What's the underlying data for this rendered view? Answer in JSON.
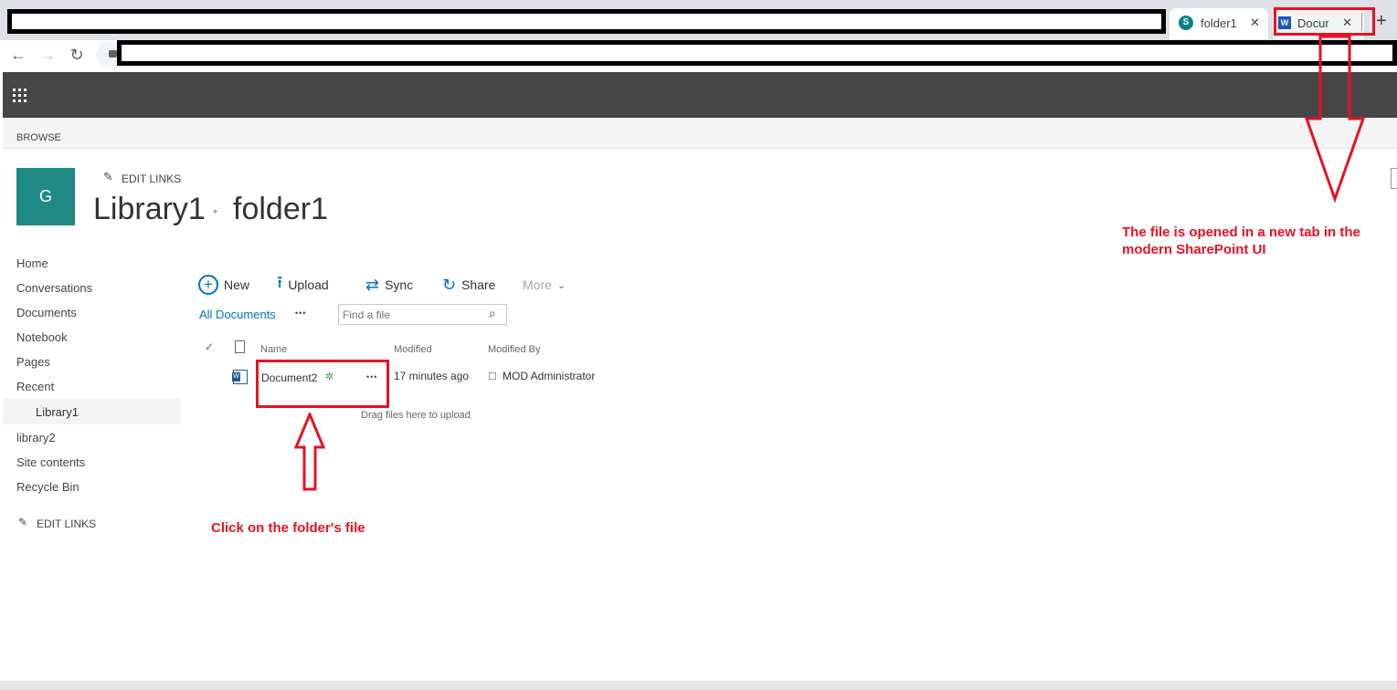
{
  "browser": {
    "tabs": [
      {
        "label": "folder1",
        "icon": "sharepoint-icon",
        "close": "✕"
      },
      {
        "label": "Docume",
        "icon": "word-icon",
        "close": "✕"
      }
    ],
    "new_tab": "+"
  },
  "ribbon": {
    "browse": "BROWSE"
  },
  "site": {
    "logo_letter": "G",
    "logo_color": "#1f8a84",
    "edit_links": "EDIT LINKS",
    "breadcrumb": {
      "library": "Library1",
      "folder": "folder1"
    }
  },
  "left_nav": {
    "items": [
      "Home",
      "Conversations",
      "Documents",
      "Notebook",
      "Pages",
      "Recent"
    ],
    "recent_child": "Library1",
    "items_after": [
      "library2",
      "Site contents",
      "Recycle Bin"
    ],
    "edit_links": "EDIT LINKS"
  },
  "commands": {
    "new": "New",
    "upload": "Upload",
    "sync": "Sync",
    "share": "Share",
    "more": "More"
  },
  "view": {
    "all_documents": "All Documents",
    "ellipsis": "•••",
    "search_placeholder": "Find a file"
  },
  "table": {
    "headers": {
      "name": "Name",
      "modified": "Modified",
      "modified_by": "Modified By"
    },
    "rows": [
      {
        "name": "Document2",
        "modified": "17 minutes ago",
        "modified_by": "MOD Administrator"
      }
    ],
    "drag_hint": "Drag files here to upload"
  },
  "annotations": {
    "click_file": "Click on the folder's file",
    "new_tab_line1": "The file is opened in a new tab in the",
    "new_tab_line2": "modern SharePoint UI",
    "color": "#e81123"
  }
}
